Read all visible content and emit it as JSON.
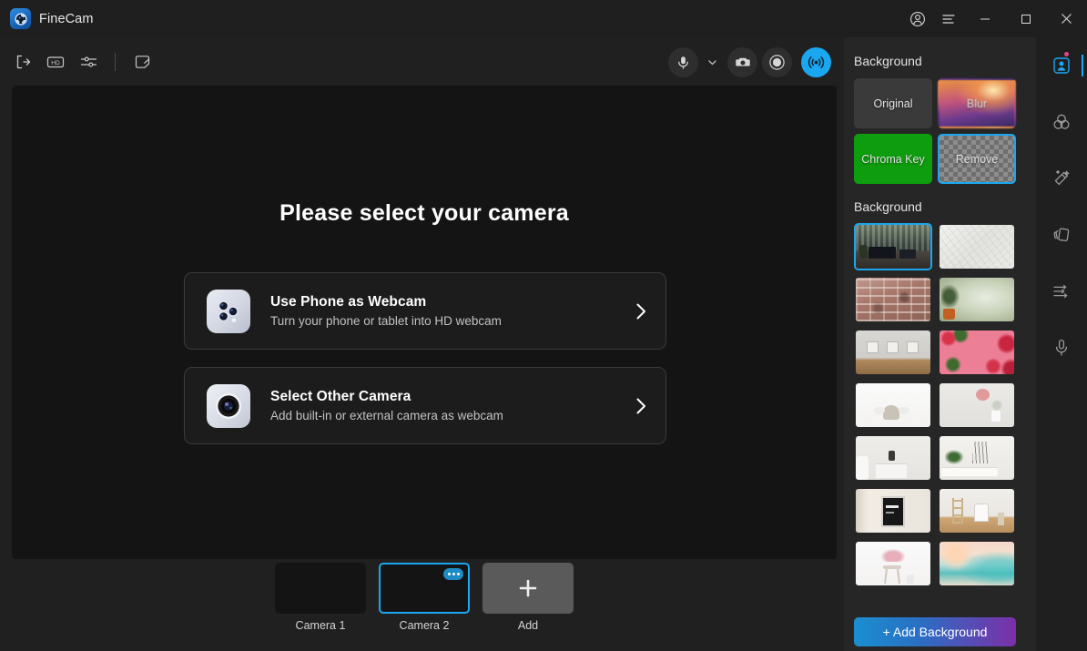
{
  "app": {
    "name": "FineCam",
    "logo_icon": "finecam-aperture-logo"
  },
  "titlebar": {
    "buttons": [
      {
        "name": "account",
        "icon": "user-circle-icon",
        "label": "Account"
      },
      {
        "name": "menu",
        "icon": "hamburger-menu-icon",
        "label": "Menu"
      },
      {
        "name": "minimize",
        "icon": "minimize-icon",
        "label": "Minimize"
      },
      {
        "name": "maximize",
        "icon": "maximize-icon",
        "label": "Maximize"
      },
      {
        "name": "close",
        "icon": "close-icon",
        "label": "Close"
      }
    ]
  },
  "toolbar": {
    "left_tools": [
      {
        "name": "export",
        "icon": "exit-arrow-icon",
        "label": "Export"
      },
      {
        "name": "hd",
        "icon": "hd-badge-icon",
        "label": "HD"
      },
      {
        "name": "settings",
        "icon": "sliders-icon",
        "label": "Settings"
      },
      {
        "name": "notes",
        "icon": "note-tag-icon",
        "label": "Notes"
      }
    ],
    "right_tools": [
      {
        "name": "microphone",
        "icon": "microphone-icon",
        "label": "Microphone"
      },
      {
        "name": "mic-dropdown",
        "icon": "chevron-down-icon",
        "label": "Select microphone"
      },
      {
        "name": "snapshot",
        "icon": "camera-icon",
        "label": "Snapshot"
      },
      {
        "name": "record",
        "icon": "record-circle-icon",
        "label": "Record"
      },
      {
        "name": "broadcast",
        "icon": "broadcast-waves-icon",
        "label": "Broadcast"
      }
    ]
  },
  "preview": {
    "title": "Please select your camera",
    "options": [
      {
        "title": "Use Phone as Webcam",
        "subtitle": "Turn your phone or tablet into HD webcam",
        "icon": "phone-triple-camera-icon",
        "arrow_icon": "chevron-right-icon"
      },
      {
        "title": "Select Other Camera",
        "subtitle": "Add built-in or external camera as webcam",
        "icon": "camera-lens-icon",
        "arrow_icon": "chevron-right-icon"
      }
    ]
  },
  "camera_strip": {
    "items": [
      {
        "label": "Camera 1",
        "selected": false,
        "has_menu": false
      },
      {
        "label": "Camera 2",
        "selected": true,
        "has_menu": true,
        "menu_icon": "ellipsis-icon"
      },
      {
        "label": "Add",
        "selected": false,
        "is_add": true,
        "icon": "plus-icon"
      }
    ]
  },
  "sidebar": {
    "section1_title": "Background",
    "modes": [
      {
        "label": "Original",
        "style": "original",
        "selected": false
      },
      {
        "label": "Blur",
        "style": "blur",
        "selected": false
      },
      {
        "label": "Chroma Key",
        "style": "chroma",
        "selected": false
      },
      {
        "label": "Remove",
        "style": "remove",
        "selected": true
      }
    ],
    "section2_title": "Background",
    "backgrounds": [
      {
        "name": "office-desk-blinds",
        "selected": true
      },
      {
        "name": "white-textured-wall",
        "selected": false
      },
      {
        "name": "red-brick-wall",
        "selected": false
      },
      {
        "name": "plant-green-wall",
        "selected": false
      },
      {
        "name": "gallery-frames-wall",
        "selected": false
      },
      {
        "name": "pink-floral-flatlay",
        "selected": false
      },
      {
        "name": "white-chair-minimal",
        "selected": false
      },
      {
        "name": "wall-art-vase",
        "selected": false
      },
      {
        "name": "white-cabinet-lamp",
        "selected": false
      },
      {
        "name": "plant-table-studio",
        "selected": false
      },
      {
        "name": "dark-poster-frame",
        "selected": false
      },
      {
        "name": "chairs-ladder-room",
        "selected": false
      },
      {
        "name": "pink-stool-pastel",
        "selected": false
      },
      {
        "name": "sunset-beach-watercolor",
        "selected": false
      }
    ],
    "add_background_label": "+ Add Background"
  },
  "rail": {
    "items": [
      {
        "name": "background",
        "icon": "portrait-background-icon",
        "active": true,
        "badge": true
      },
      {
        "name": "color-adjust",
        "icon": "color-circles-icon",
        "active": false,
        "badge": false
      },
      {
        "name": "beautify",
        "icon": "magic-wand-icon",
        "active": false,
        "badge": false
      },
      {
        "name": "layers",
        "icon": "layers-cards-icon",
        "active": false,
        "badge": false
      },
      {
        "name": "adjustments",
        "icon": "equalizer-sliders-icon",
        "active": false,
        "badge": false
      },
      {
        "name": "audio",
        "icon": "microphone-icon",
        "active": false,
        "badge": false
      }
    ]
  },
  "colors": {
    "accent": "#1ba7f0",
    "chroma_green": "#0e9d0e",
    "badge_pink": "#e0448c",
    "window_bg": "#202020",
    "sidebar_bg": "#262626"
  }
}
